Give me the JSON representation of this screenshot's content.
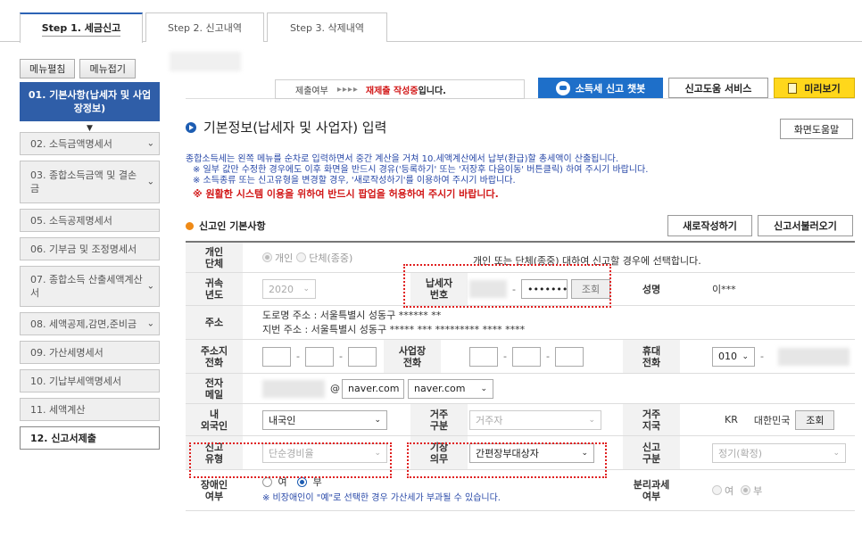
{
  "tabs": [
    {
      "label": "Step 1. 세금신고"
    },
    {
      "label": "Step 2. 신고내역"
    },
    {
      "label": "Step 3. 삭제내역"
    }
  ],
  "sidebar": {
    "expand_label": "메뉴펼침",
    "collapse_label": "메뉴접기",
    "items": [
      {
        "label": "01. 기본사항(납세자 및 사업장정보)"
      },
      {
        "label": "02. 소득금액명세서"
      },
      {
        "label": "03. 종합소득금액 및 결손금"
      },
      {
        "label": "05. 소득공제명세서"
      },
      {
        "label": "06. 기부금 및 조정명세서"
      },
      {
        "label": "07. 종합소득 산출세액계산서"
      },
      {
        "label": "08. 세액공제,감면,준비금"
      },
      {
        "label": "09. 가산세명세서"
      },
      {
        "label": "10. 기납부세액명세서"
      },
      {
        "label": "11. 세액계산"
      },
      {
        "label": "12. 신고서제출"
      }
    ]
  },
  "toolbar": {
    "status_prefix": "제출여부",
    "status_arrows": "▸▸▸▸",
    "status_value": "재제출 작성중",
    "status_suffix": "입니다.",
    "chatbot_label": "소득세 신고 챗봇",
    "guide_label": "신고도움 서비스",
    "preview_label": "미리보기"
  },
  "main": {
    "title": "기본정보(납세자 및 사업자) 입력",
    "help_label": "화면도움말",
    "intro": [
      "종합소득세는 왼쪽 메뉴를 순차로 입력하면서 중간 계산을 거쳐 10.세액계산에서 납부(환급)할 총세액이 산출됩니다.",
      "※ 일부 값만 수정한 경우에도 이후 화면을 반드시 경유('등록하기' 또는 '저장후 다음이동' 버튼클릭) 하여 주시기 바랍니다.",
      "※ 소득종류 또는 신고유형을 변경할 경우, '새로작성하기'를 이용하여 주시기 바랍니다."
    ],
    "warning": "※ 원활한 시스템 이용을 위하여 반드시 팝업을 허용하여 주시기 바랍니다.",
    "section_title": "신고인 기본사항",
    "new_label": "새로작성하기",
    "load_label": "신고서불러오기"
  },
  "form": {
    "type_label": "개인\n단체",
    "type_options": [
      "개인",
      "단체(종중)"
    ],
    "type_note": "개인 또는 단체(종중) 대하여 신고할 경우에 선택합니다.",
    "year_label": "귀속\n년도",
    "year_value": "2020",
    "taxpayer_no_label": "납세자\n번호",
    "taxpayer_no_masked": "•••••••",
    "lookup_label": "조회",
    "name_label": "성명",
    "name_value": "이***",
    "address_label": "주소",
    "road_address": "도로명 주소 :   서울특별시 성동구 ****** **",
    "lot_address": "지번 주소 :   서울특별시 성동구 ***** *** ********* **** ****",
    "home_phone_label": "주소지\n전화",
    "biz_phone_label": "사업장\n전화",
    "mobile_label": "휴대\n전화",
    "mobile_prefix": "010",
    "email_label": "전자\n메일",
    "email_domain_input": "naver.com",
    "email_domain_select": "naver.com",
    "foreign_label": "내\n외국인",
    "foreign_value": "내국인",
    "residency_label": "거주\n구분",
    "residency_value": "거주자",
    "country_label": "거주\n지국",
    "country_code": "KR",
    "country_name": "대한민국",
    "country_lookup": "조회",
    "report_type_label": "신고\n유형",
    "report_type_value": "단순경비율",
    "bookkeeping_label": "기장\n의무",
    "bookkeeping_value": "간편장부대상자",
    "report_class_label": "신고\n구분",
    "report_class_value": "정기(확정)",
    "disabled_label": "장애인\n여부",
    "yes_label": "여",
    "no_label": "부",
    "disabled_note": "※ 비장애인이 \"예\"로 선택한 경우 가산세가 부과될 수 있습니다.",
    "separate_tax_label": "분리과세\n여부"
  },
  "colors": {
    "primary": "#2f5ea8",
    "chat": "#1e6fc9",
    "preview": "#ffd71b",
    "warning": "#d21919",
    "info_text": "#2848a8",
    "highlight_box": "#e02020"
  }
}
